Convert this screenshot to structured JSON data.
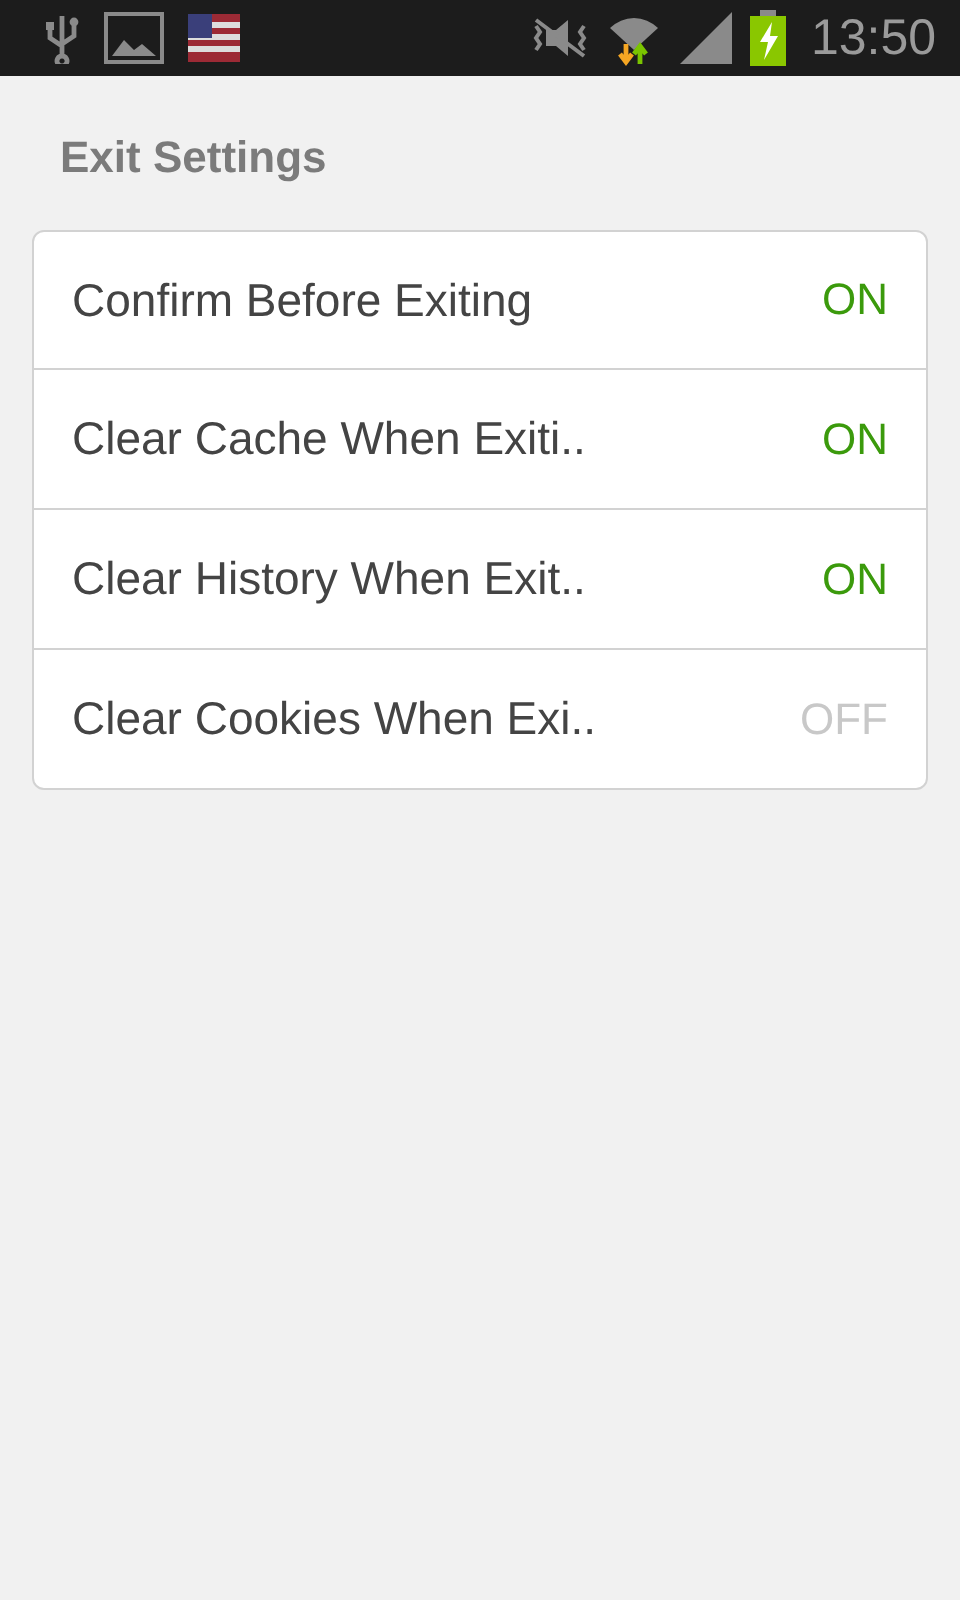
{
  "status_bar": {
    "time": "13:50"
  },
  "section": {
    "title": "Exit Settings"
  },
  "settings": [
    {
      "label": "Confirm Before Exiting",
      "value": "ON",
      "on": true
    },
    {
      "label": "Clear Cache When Exiti..",
      "value": "ON",
      "on": true
    },
    {
      "label": "Clear History When Exit..",
      "value": "ON",
      "on": true
    },
    {
      "label": "Clear Cookies When Exi..",
      "value": "OFF",
      "on": false
    }
  ]
}
